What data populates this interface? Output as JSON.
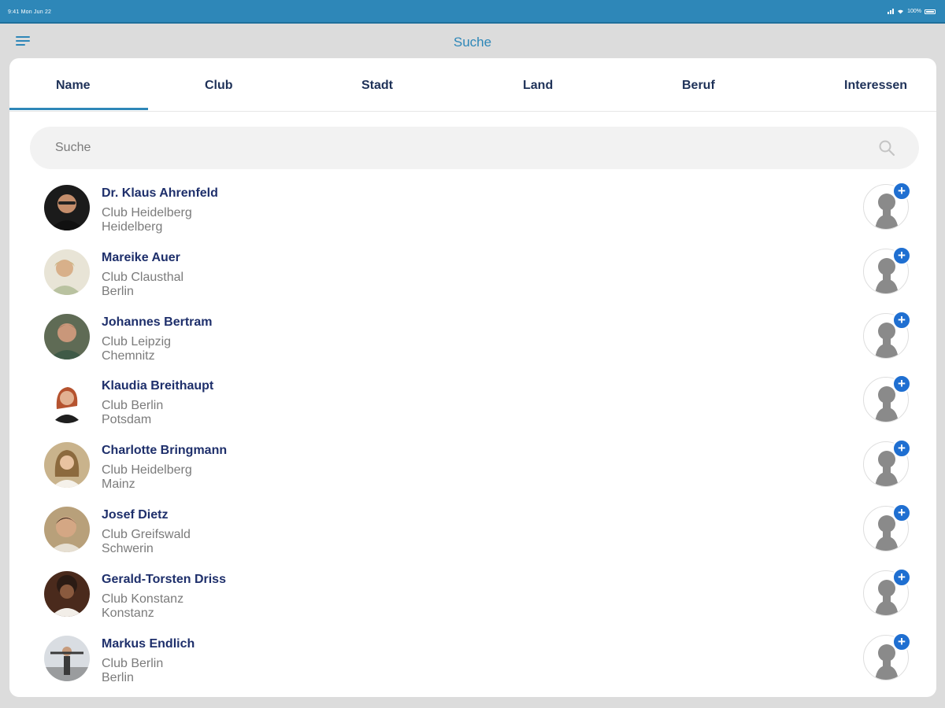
{
  "status_bar": {
    "left_text": "9:41  Mon Jun 22",
    "right_text": "100%"
  },
  "nav": {
    "title": "Suche"
  },
  "tabs": [
    {
      "label": "Name",
      "active": true
    },
    {
      "label": "Club",
      "active": false
    },
    {
      "label": "Stadt",
      "active": false
    },
    {
      "label": "Land",
      "active": false
    },
    {
      "label": "Beruf",
      "active": false
    },
    {
      "label": "Interessen",
      "active": false
    }
  ],
  "search": {
    "placeholder": "Suche",
    "value": ""
  },
  "members": [
    {
      "name": "Dr. Klaus Ahrenfeld",
      "club": "Club Heidelberg",
      "city": "Heidelberg"
    },
    {
      "name": "Mareike Auer",
      "club": "Club Clausthal",
      "city": "Berlin"
    },
    {
      "name": "Johannes Bertram",
      "club": "Club Leipzig",
      "city": "Chemnitz"
    },
    {
      "name": "Klaudia Breithaupt",
      "club": "Club Berlin",
      "city": "Potsdam"
    },
    {
      "name": "Charlotte Bringmann",
      "club": "Club Heidelberg",
      "city": "Mainz"
    },
    {
      "name": "Josef Dietz",
      "club": "Club Greifswald",
      "city": "Schwerin"
    },
    {
      "name": "Gerald-Torsten Driss",
      "club": "Club Konstanz",
      "city": "Konstanz"
    },
    {
      "name": "Markus Endlich",
      "club": "Club Berlin",
      "city": "Berlin"
    }
  ],
  "add_badge": {
    "symbol": "+"
  },
  "colors": {
    "accent": "#2e87b8",
    "name_text": "#1e2f6b",
    "secondary_text": "#7b7b7b",
    "badge": "#1f6fd1",
    "background": "#dcdcdc"
  }
}
